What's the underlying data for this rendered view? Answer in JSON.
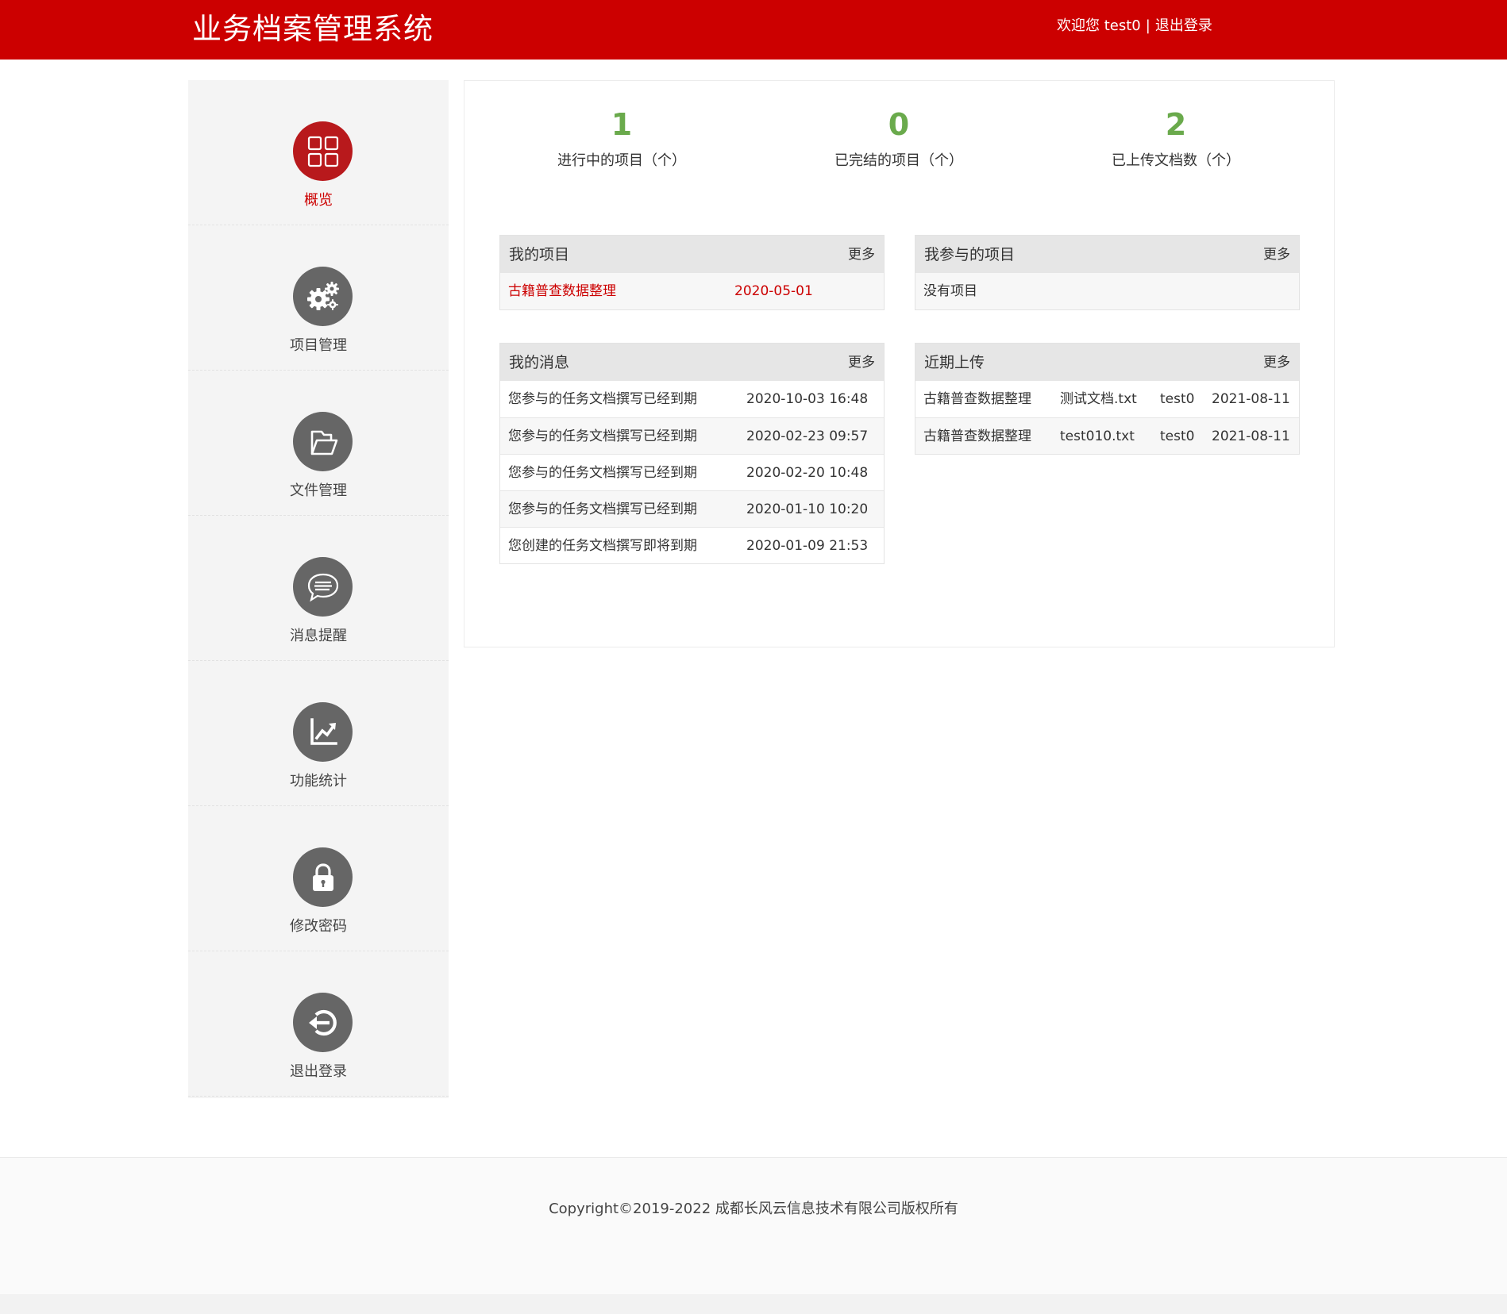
{
  "header": {
    "title": "业务档案管理系统",
    "welcome": "欢迎您 test0",
    "separator": "|",
    "logout": "退出登录"
  },
  "sidebar": {
    "items": [
      {
        "label": "概览",
        "icon": "grid-icon",
        "active": true
      },
      {
        "label": "项目管理",
        "icon": "gears-icon"
      },
      {
        "label": "文件管理",
        "icon": "folder-open-icon"
      },
      {
        "label": "消息提醒",
        "icon": "chat-bubble-icon"
      },
      {
        "label": "功能统计",
        "icon": "line-chart-icon"
      },
      {
        "label": "修改密码",
        "icon": "lock-icon"
      },
      {
        "label": "退出登录",
        "icon": "exit-arrow-icon"
      }
    ]
  },
  "stats": [
    {
      "value": "1",
      "label": "进行中的项目（个）"
    },
    {
      "value": "0",
      "label": "已完结的项目（个）"
    },
    {
      "value": "2",
      "label": "已上传文档数（个）"
    }
  ],
  "my_projects": {
    "title": "我的项目",
    "more": "更多",
    "rows": [
      {
        "name": "古籍普查数据整理",
        "date": "2020-05-01"
      }
    ]
  },
  "joined_projects": {
    "title": "我参与的项目",
    "more": "更多",
    "empty": "没有项目"
  },
  "my_messages": {
    "title": "我的消息",
    "more": "更多",
    "rows": [
      {
        "text": "您参与的任务文档撰写已经到期",
        "time": "2020-10-03 16:48"
      },
      {
        "text": "您参与的任务文档撰写已经到期",
        "time": "2020-02-23 09:57"
      },
      {
        "text": "您参与的任务文档撰写已经到期",
        "time": "2020-02-20 10:48"
      },
      {
        "text": "您参与的任务文档撰写已经到期",
        "time": "2020-01-10 10:20"
      },
      {
        "text": "您创建的任务文档撰写即将到期",
        "time": "2020-01-09 21:53"
      }
    ]
  },
  "recent_uploads": {
    "title": "近期上传",
    "more": "更多",
    "rows": [
      {
        "project": "古籍普查数据整理",
        "file": "测试文档.txt",
        "user": "test0",
        "date": "2021-08-11"
      },
      {
        "project": "古籍普查数据整理",
        "file": "test010.txt",
        "user": "test0",
        "date": "2021-08-11"
      }
    ]
  },
  "footer": {
    "copyright": "Copyright©2019-2022  成都长风云信息技术有限公司版权所有"
  },
  "colors": {
    "brand_red": "#cc0000",
    "active_icon": "#b8191c",
    "stat_green": "#6aaa4c",
    "icon_gray": "#666666"
  }
}
